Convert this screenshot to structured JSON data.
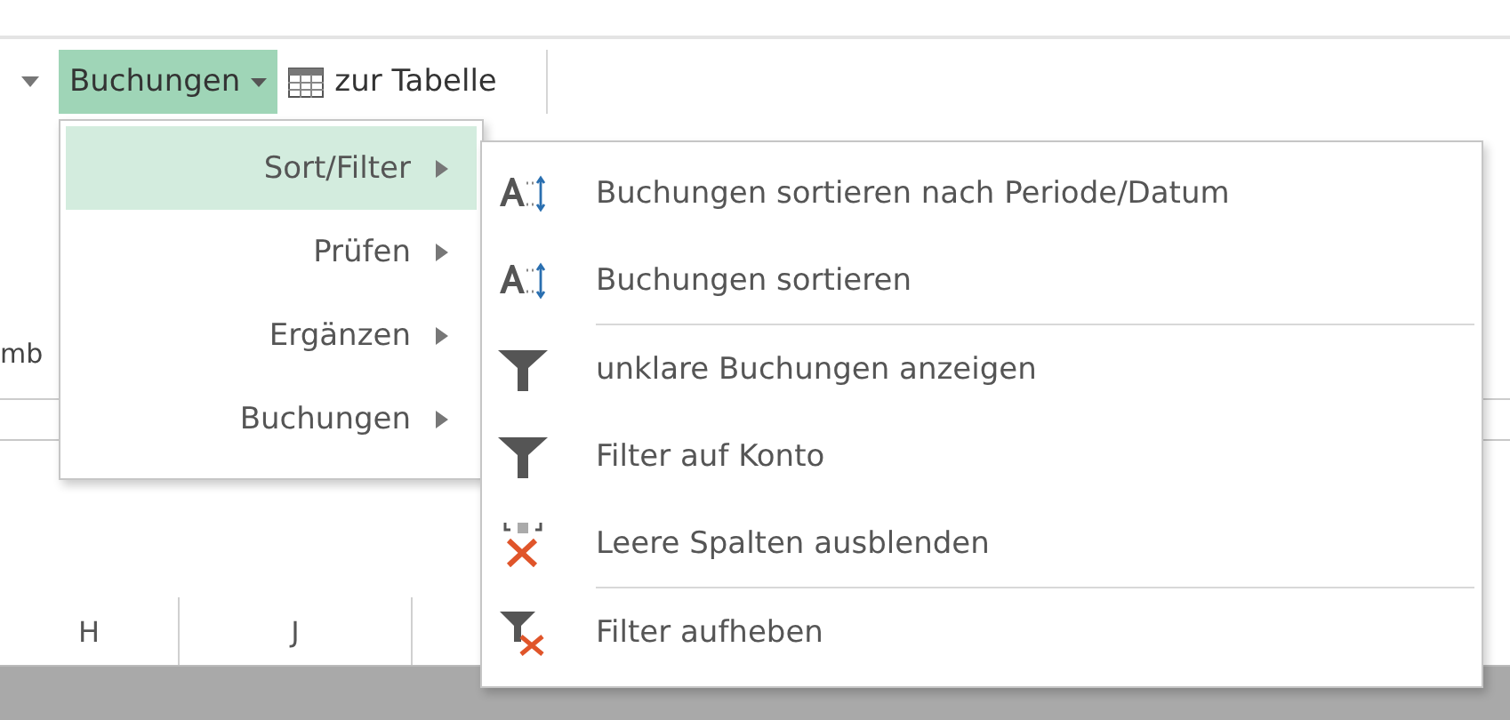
{
  "ribbon": {
    "buttons": [
      {
        "label": "Buchungen",
        "kind": "dropdown",
        "selected": true
      },
      {
        "label": "zur Tabelle",
        "kind": "table",
        "selected": false
      }
    ]
  },
  "sheet": {
    "cut_label": "mb",
    "column_headers": [
      "H",
      "J"
    ]
  },
  "menu": {
    "items": [
      {
        "label": "Sort/Filter",
        "selected": true
      },
      {
        "label": "Prüfen",
        "selected": false
      },
      {
        "label": "Ergänzen",
        "selected": false
      },
      {
        "label": "Buchungen",
        "selected": false
      }
    ]
  },
  "submenu": {
    "items": [
      {
        "label": "Buchungen sortieren nach Periode/Datum",
        "kind": "sort",
        "separator_before": false
      },
      {
        "label": "Buchungen sortieren",
        "kind": "sort",
        "separator_before": false
      },
      {
        "label": "unklare Buchungen anzeigen",
        "kind": "filter",
        "separator_before": true
      },
      {
        "label": "Filter auf Konto",
        "kind": "filter",
        "separator_before": false
      },
      {
        "label": "Leere Spalten ausblenden",
        "kind": "hide-columns",
        "separator_before": false
      },
      {
        "label": "Filter aufheben",
        "kind": "clear-filter",
        "separator_before": true
      }
    ]
  }
}
